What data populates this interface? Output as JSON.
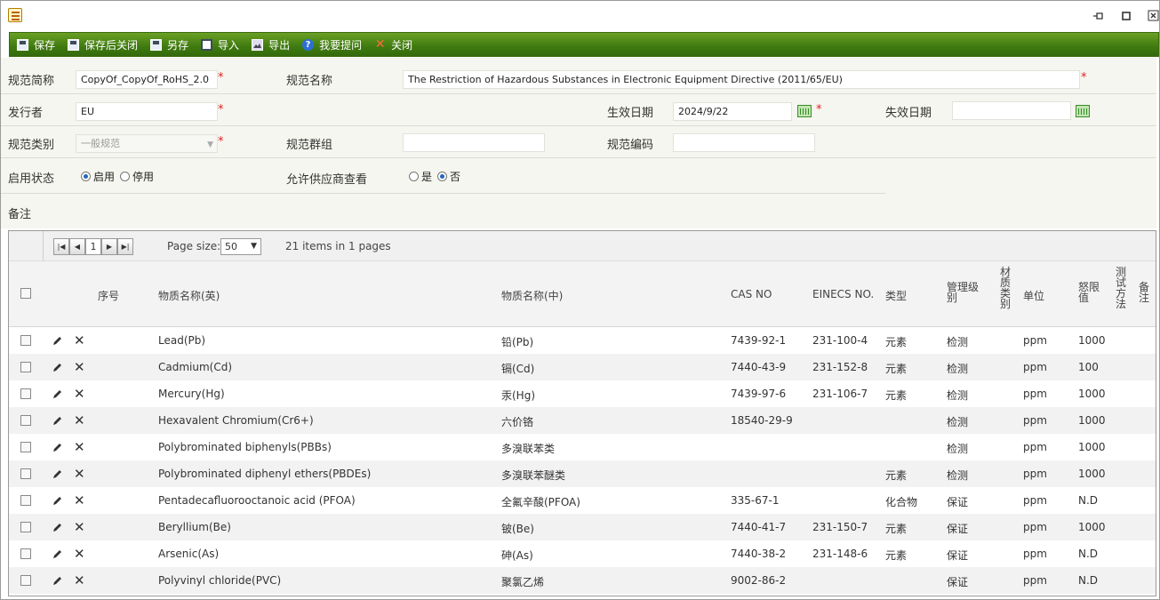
{
  "window": {
    "icons": {
      "app": "document-icon",
      "pin": "pin-icon",
      "maximize": "maximize-icon",
      "close": "close-icon"
    }
  },
  "toolbar": {
    "buttons": [
      {
        "label": "保存",
        "icon": "save-icon"
      },
      {
        "label": "保存后关闭",
        "icon": "save-close-icon"
      },
      {
        "label": "另存",
        "icon": "save-as-icon"
      },
      {
        "label": "导入",
        "icon": "import-icon"
      },
      {
        "label": "导出",
        "icon": "export-icon"
      },
      {
        "label": "我要提问",
        "icon": "help-icon"
      },
      {
        "label": "关闭",
        "icon": "close-icon"
      }
    ]
  },
  "form": {
    "short_name_label": "规范简称",
    "short_name_value": "CopyOf_CopyOf_RoHS_2.0",
    "full_name_label": "规范名称",
    "full_name_value": "The Restriction of Hazardous Substances in Electronic Equipment Directive (2011/65/EU)",
    "issuer_label": "发行者",
    "issuer_value": "EU",
    "effective_date_label": "生效日期",
    "effective_date_value": "2024/9/22",
    "expire_date_label": "失效日期",
    "expire_date_value": "",
    "category_label": "规范类别",
    "category_value": "一般规范",
    "group_label": "规范群组",
    "group_value": "",
    "code_label": "规范编码",
    "code_value": "",
    "status_label": "启用状态",
    "status_options": [
      "启用",
      "停用"
    ],
    "status_selected": "启用",
    "supplier_view_label": "允许供应商查看",
    "supplier_view_options": [
      "是",
      "否"
    ],
    "supplier_view_selected": "否",
    "remark_label": "备注",
    "required_mark": "*"
  },
  "pager": {
    "current_page": "1",
    "page_size_label": "Page size:",
    "page_size_value": "50",
    "summary": "21 items in 1 pages"
  },
  "table": {
    "headers": {
      "seq": "序号",
      "name_en": "物质名称(英)",
      "name_cn": "物质名称(中)",
      "cas": "CAS NO",
      "einecs": "EINECS NO.",
      "type": "类型",
      "mgmt_level": "管理级别",
      "material_category": "材质类别",
      "unit": "单位",
      "threshold": "怒限值",
      "test_method": "测试方法",
      "remark": "备注"
    },
    "rows": [
      {
        "name_en": "Lead(Pb)",
        "name_cn": "铅(Pb)",
        "cas": "7439-92-1",
        "einecs": "231-100-4",
        "type": "元素",
        "level": "检测",
        "unit": "ppm",
        "limit": "1000"
      },
      {
        "name_en": "Cadmium(Cd)",
        "name_cn": "镉(Cd)",
        "cas": "7440-43-9",
        "einecs": "231-152-8",
        "type": "元素",
        "level": "检测",
        "unit": "ppm",
        "limit": "100"
      },
      {
        "name_en": "Mercury(Hg)",
        "name_cn": "汞(Hg)",
        "cas": "7439-97-6",
        "einecs": "231-106-7",
        "type": "元素",
        "level": "检测",
        "unit": "ppm",
        "limit": "1000"
      },
      {
        "name_en": "Hexavalent Chromium(Cr6+)",
        "name_cn": "六价铬",
        "cas": "18540-29-9",
        "einecs": "",
        "type": "",
        "level": "检测",
        "unit": "ppm",
        "limit": "1000"
      },
      {
        "name_en": "Polybrominated biphenyls(PBBs)",
        "name_cn": "多溴联苯类",
        "cas": "",
        "einecs": "",
        "type": "",
        "level": "检测",
        "unit": "ppm",
        "limit": "1000"
      },
      {
        "name_en": "Polybrominated diphenyl ethers(PBDEs)",
        "name_cn": "多溴联苯醚类",
        "cas": "",
        "einecs": "",
        "type": "元素",
        "level": "检测",
        "unit": "ppm",
        "limit": "1000"
      },
      {
        "name_en": "Pentadecafluorooctanoic acid (PFOA)",
        "name_cn": "全氟辛酸(PFOA)",
        "cas": "335-67-1",
        "einecs": "",
        "type": "化合物",
        "level": "保证",
        "unit": "ppm",
        "limit": "N.D"
      },
      {
        "name_en": "Beryllium(Be)",
        "name_cn": "铍(Be)",
        "cas": "7440-41-7",
        "einecs": "231-150-7",
        "type": "元素",
        "level": "保证",
        "unit": "ppm",
        "limit": "1000"
      },
      {
        "name_en": "Arsenic(As)",
        "name_cn": "砷(As)",
        "cas": "7440-38-2",
        "einecs": "231-148-6",
        "type": "元素",
        "level": "保证",
        "unit": "ppm",
        "limit": "N.D"
      },
      {
        "name_en": "Polyvinyl chloride(PVC)",
        "name_cn": "聚氯乙烯",
        "cas": "9002-86-2",
        "einecs": "",
        "type": "",
        "level": "保证",
        "unit": "ppm",
        "limit": "N.D"
      }
    ]
  }
}
